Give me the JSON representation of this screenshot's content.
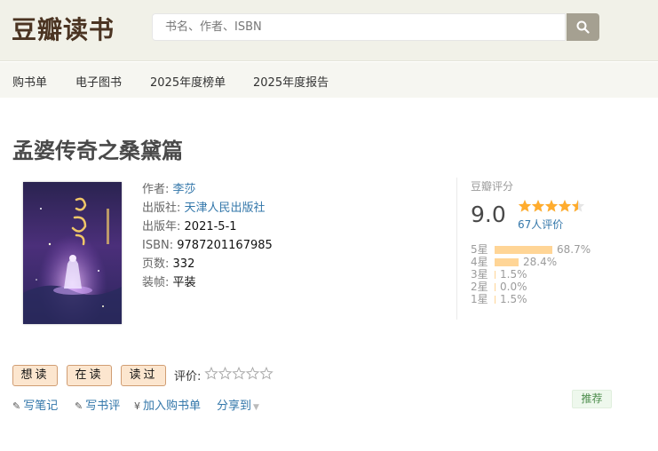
{
  "header": {
    "logo": "豆瓣读书",
    "search_placeholder": "书名、作者、ISBN"
  },
  "nav": {
    "items": [
      "购书单",
      "电子图书",
      "2025年度榜单",
      "2025年度报告"
    ]
  },
  "book": {
    "title": "孟婆传奇之桑黛篇",
    "cover_alt": "孟婆传奇之桑黛篇 封面",
    "info": [
      {
        "label": "作者:",
        "value": "李莎",
        "link": true
      },
      {
        "label": "出版社:",
        "value": "天津人民出版社",
        "link": true
      },
      {
        "label": "出版年:",
        "value": "2021-5-1",
        "link": false
      },
      {
        "label": "ISBN:",
        "value": "9787201167985",
        "link": false
      },
      {
        "label": "页数:",
        "value": "332",
        "link": false
      },
      {
        "label": "装帧:",
        "value": "平装",
        "link": false
      }
    ]
  },
  "rating": {
    "label": "豆瓣评分",
    "score": "9.0",
    "stars": 4.5,
    "count": "67人评价",
    "distribution": [
      {
        "label": "5星",
        "pct": "68.7%",
        "fraction": 0.687
      },
      {
        "label": "4星",
        "pct": "28.4%",
        "fraction": 0.284
      },
      {
        "label": "3星",
        "pct": "1.5%",
        "fraction": 0.015
      },
      {
        "label": "2星",
        "pct": "0.0%",
        "fraction": 0.0
      },
      {
        "label": "1星",
        "pct": "1.5%",
        "fraction": 0.015
      }
    ]
  },
  "actions": {
    "want": "想读",
    "reading": "在读",
    "read": "读过",
    "rate_label": "评价:",
    "write_note": "写笔记",
    "write_review": "写书评",
    "add_cart": "加入购书单",
    "share": "分享到",
    "recommend": "推荐"
  },
  "colors": {
    "link": "#3377aa",
    "bar": "#ffd596",
    "star": "#ffac2d",
    "logo": "#4b3422"
  }
}
